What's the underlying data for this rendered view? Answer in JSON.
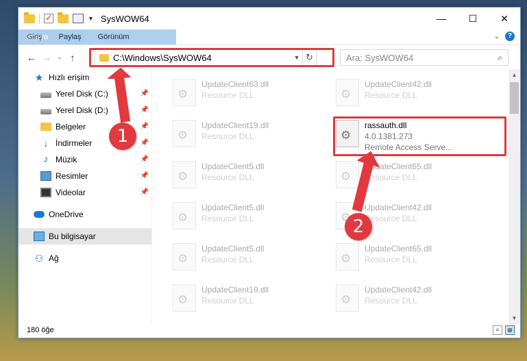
{
  "window": {
    "title": "SysWOW64",
    "controls": {
      "minimize": "—",
      "maximize": "☐",
      "close": "✕"
    }
  },
  "ribbon": {
    "tabs": [
      {
        "label": "Dosya"
      },
      {
        "label": "Giriş"
      },
      {
        "label": "Paylaş"
      },
      {
        "label": "Görünüm"
      }
    ],
    "collapse_icon": "chevron-down-icon",
    "help_icon": "?"
  },
  "nav": {
    "back": "←",
    "forward": "→",
    "recent": "⌄",
    "up": "↑",
    "address": "C:\\Windows\\SysWOW64",
    "refresh": "↻",
    "search_placeholder": "Ara: SysWOW64",
    "search_icon": "⌕"
  },
  "sidebar": {
    "items": [
      {
        "label": "Hızlı erişim",
        "icon": "star-icon",
        "pinned": false
      },
      {
        "label": "Yerel Disk (C:)",
        "icon": "disk-icon",
        "pinned": true
      },
      {
        "label": "Yerel Disk (D:)",
        "icon": "disk-icon",
        "pinned": true
      },
      {
        "label": "Belgeler",
        "icon": "documents-icon",
        "pinned": true
      },
      {
        "label": "İndirmeler",
        "icon": "download-icon",
        "pinned": true
      },
      {
        "label": "Müzik",
        "icon": "music-icon",
        "pinned": true
      },
      {
        "label": "Resimler",
        "icon": "pictures-icon",
        "pinned": true
      },
      {
        "label": "Videolar",
        "icon": "video-icon",
        "pinned": true
      },
      {
        "label": "OneDrive",
        "icon": "cloud-icon",
        "pinned": false
      },
      {
        "label": "Bu bilgisayar",
        "icon": "computer-icon",
        "pinned": false,
        "selected": true
      },
      {
        "label": "Ağ",
        "icon": "network-icon",
        "pinned": false
      }
    ]
  },
  "files": [
    {
      "name": "UpdateClient63.dll",
      "sub": "Resource DLL"
    },
    {
      "name": "UpdateClient42.dll",
      "sub": "Resource DLL"
    },
    {
      "name": "UpdateClient19.dll",
      "sub": "Resource DLL"
    },
    {
      "name": "rassauth.dll",
      "sub": "4.0.1381.273",
      "sub2": "Remote Access Serve...",
      "active": true
    },
    {
      "name": "UpdateClient5.dll",
      "sub": "Resource DLL"
    },
    {
      "name": "UpdateClient65.dll",
      "sub": "Resource DLL"
    },
    {
      "name": "UpdateClient5.dll",
      "sub": "Resource DLL"
    },
    {
      "name": "UpdateClient42.dll",
      "sub": "Resource DLL"
    },
    {
      "name": "UpdateClient5.dll",
      "sub": "Resource DLL"
    },
    {
      "name": "UpdateClient65.dll",
      "sub": "Resource DLL"
    },
    {
      "name": "UpdateClient19.dll",
      "sub": "Resource DLL"
    },
    {
      "name": "UpdateClient42.dll",
      "sub": "Resource DLL"
    }
  ],
  "status": {
    "count": "180 öğe"
  },
  "callouts": {
    "one": "1",
    "two": "2"
  },
  "colors": {
    "accent": "#1979ca",
    "highlight": "#e0393e"
  }
}
